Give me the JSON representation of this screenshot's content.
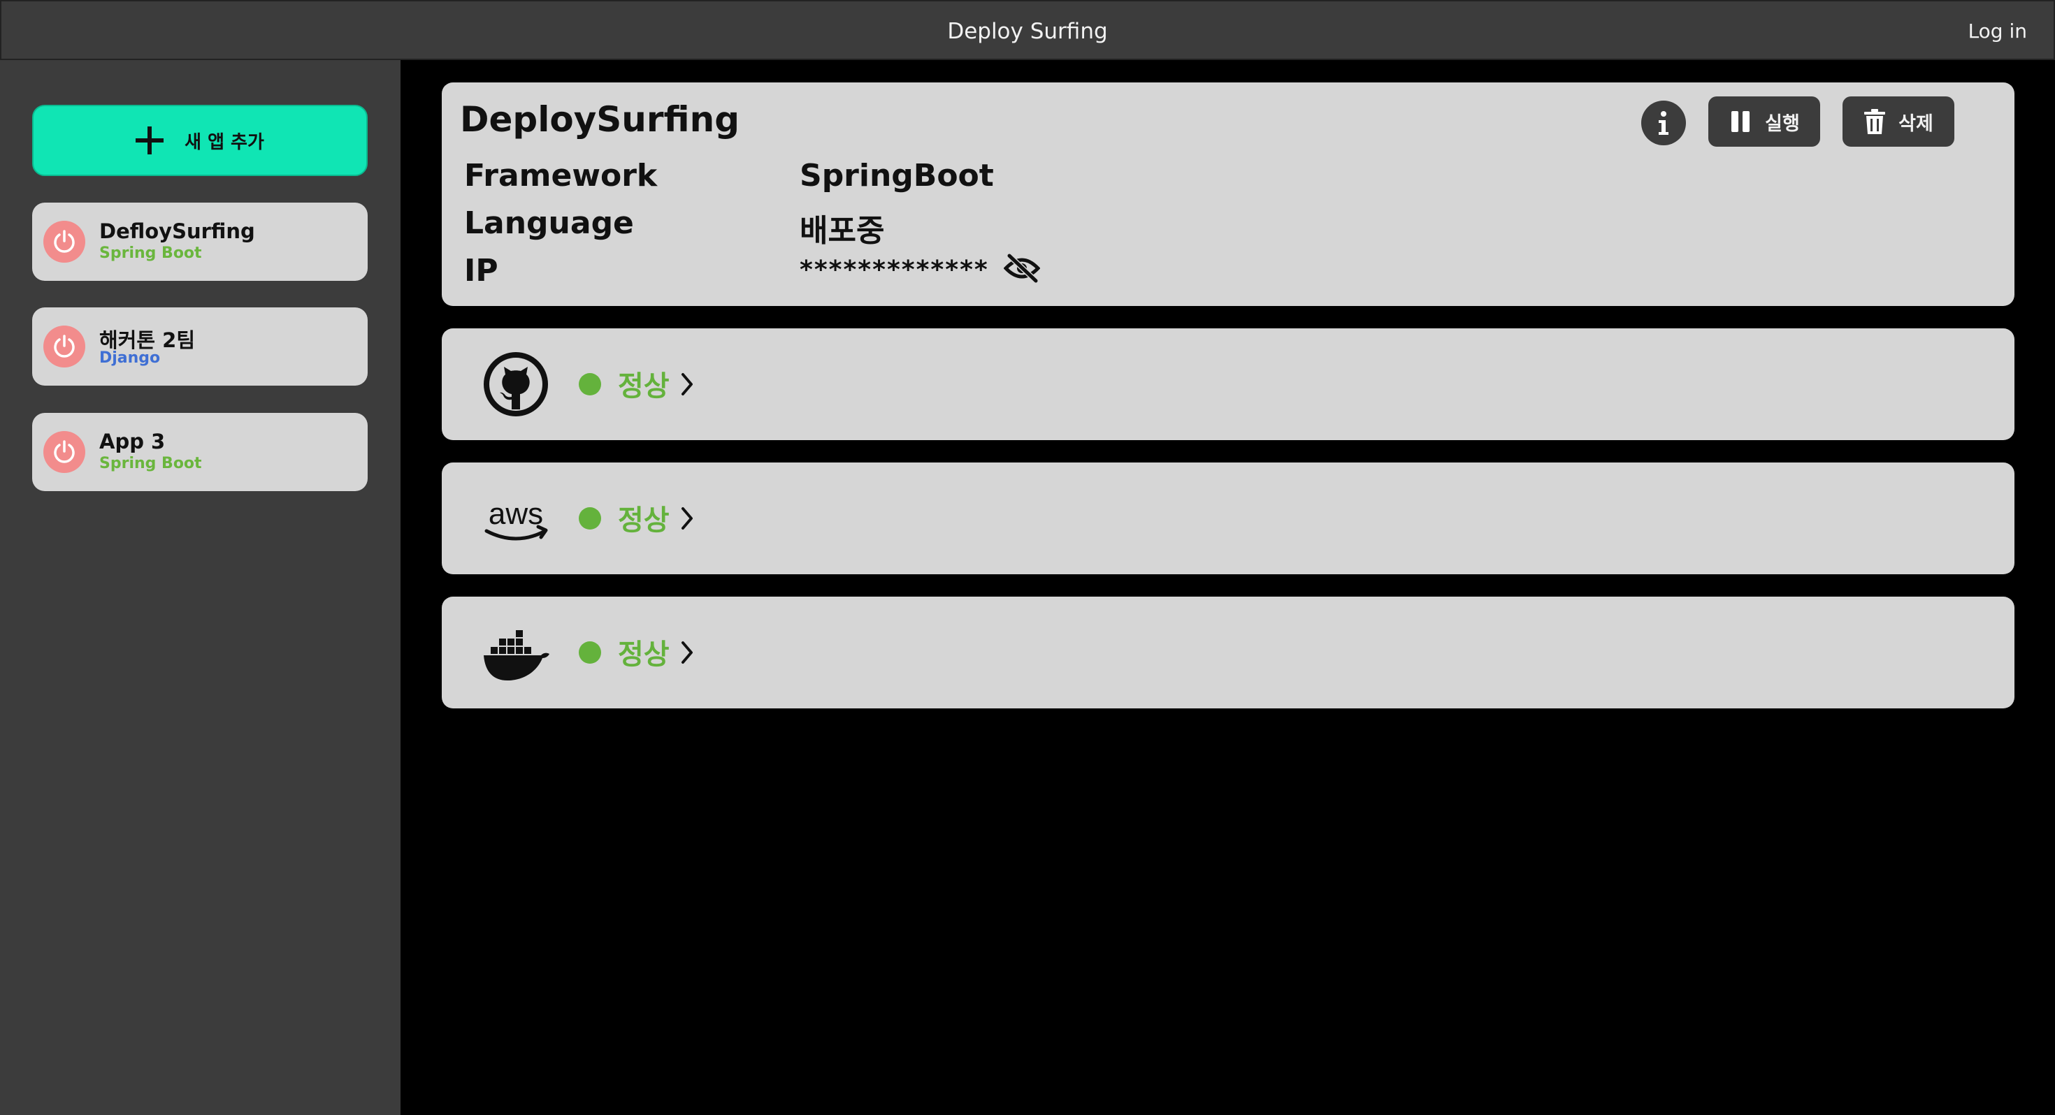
{
  "topbar": {
    "title": "Deploy Surfing",
    "login": "Log in"
  },
  "sidebar": {
    "add_label": "새 앱 추가",
    "apps": [
      {
        "name": "DefloySurfing",
        "framework": "Spring Boot",
        "framework_color": "#6ab63d"
      },
      {
        "name": "해커톤 2팀",
        "framework": "Django",
        "framework_color": "#3f6fd4"
      },
      {
        "name": "App 3",
        "framework": "Spring Boot",
        "framework_color": "#6ab63d"
      }
    ]
  },
  "detail": {
    "app_title": "DeploySurfing",
    "run_label": "실행",
    "delete_label": "삭제",
    "fields": [
      {
        "label": "Framework",
        "value": "SpringBoot"
      },
      {
        "label": "Language",
        "value": "배포중"
      },
      {
        "label": "IP",
        "value": "*************"
      }
    ]
  },
  "services": [
    {
      "icon": "github-icon",
      "status": "정상"
    },
    {
      "icon": "aws-icon",
      "status": "정상"
    },
    {
      "icon": "docker-icon",
      "status": "정상"
    }
  ],
  "colors": {
    "accent": "#10e5b4",
    "status_ok": "#64b23c",
    "power": "#f28c8c",
    "panel": "#d6d6d6",
    "chrome": "#3c3c3c"
  }
}
